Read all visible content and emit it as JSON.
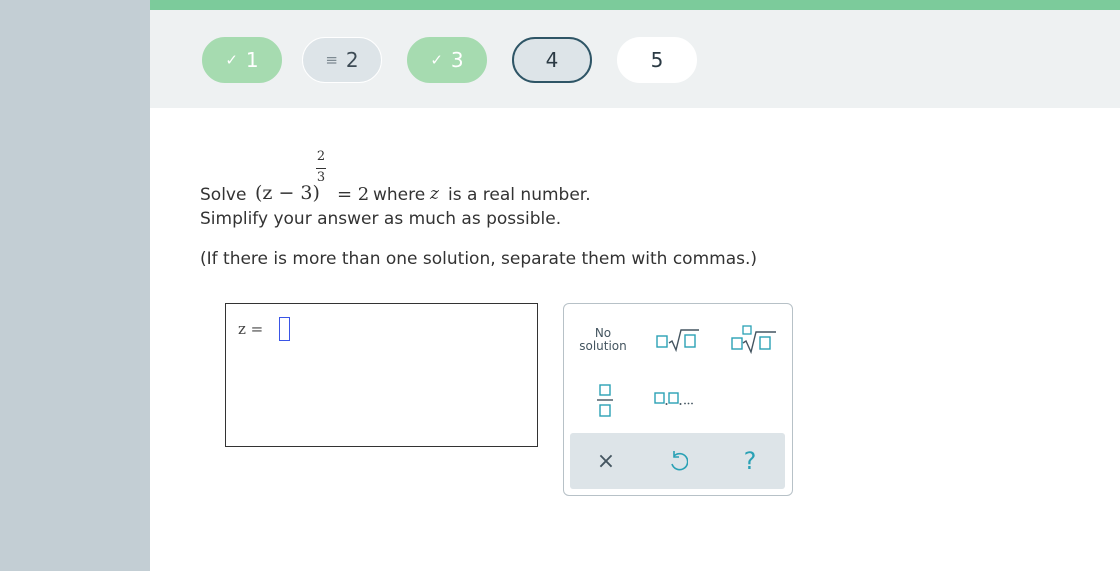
{
  "steps": [
    {
      "label": "1",
      "status": "correct",
      "marker": "✓"
    },
    {
      "label": "2",
      "status": "partial",
      "marker": "≡"
    },
    {
      "label": "3",
      "status": "correct",
      "marker": "✓"
    },
    {
      "label": "4",
      "status": "current",
      "marker": ""
    },
    {
      "label": "5",
      "status": "unanswered",
      "marker": ""
    }
  ],
  "question": {
    "solve_word": "Solve",
    "base": "(z − 3)",
    "exponent_num": "2",
    "exponent_den": "3",
    "equals": "= 2",
    "where_text": "where",
    "var": "z",
    "tail": "is a real number.",
    "line2": "Simplify your answer as much as possible.",
    "line3": "(If there is more than one solution, separate them with commas.)"
  },
  "answer": {
    "label": "z =",
    "value": ""
  },
  "keypad": {
    "no_solution_line1": "No",
    "no_solution_line2": "solution",
    "list_separator_label": "□,□,...",
    "clear_symbol": "×",
    "help_symbol": "?"
  },
  "colors": {
    "progress": "#7ccb9b",
    "correct_pill": "#a6dbb0",
    "current_border": "#2e5566",
    "accent_teal": "#2aa1b5",
    "cursor": "#3a55e6"
  }
}
